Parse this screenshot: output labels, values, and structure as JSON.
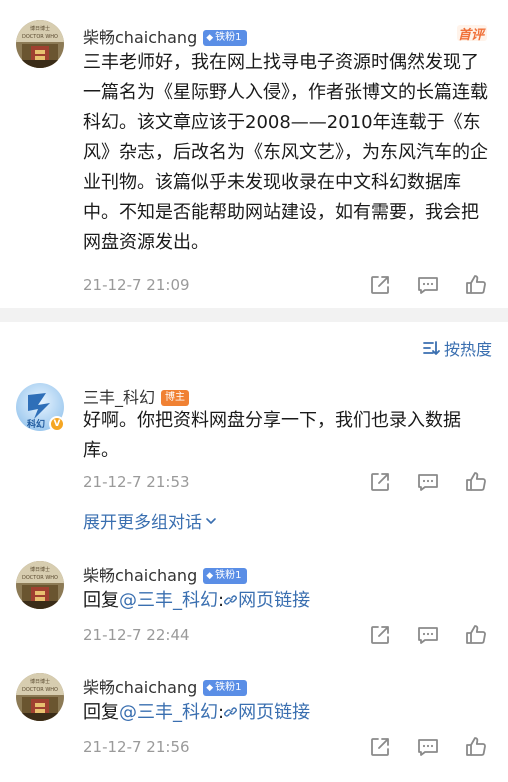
{
  "post": {
    "author": "柴畅chaichang",
    "fan_badge": "铁粉1",
    "first_tag": "首评",
    "text": "三丰老师好，我在网上找寻电子资源时偶然发现了一篇名为《星际野人入侵》，作者张博文的长篇连载科幻。该文章应该于2008——2010年连载于《东风》杂志，后改名为《东风文艺》，为东风汽车的企业刊物。该篇似乎未发现收录在中文科幻数据库中。不知是否能帮助网站建设，如有需要，我会把网盘资源发出。",
    "time": "21-12-7 21:09"
  },
  "sort": {
    "label": "按热度"
  },
  "reply1": {
    "author": "三丰_科幻",
    "host_badge": "博主",
    "text": "好啊。你把资料网盘分享一下，我们也录入数据库。",
    "time": "21-12-7 21:53"
  },
  "expand": {
    "label": "展开更多组对话"
  },
  "reply2": {
    "author": "柴畅chaichang",
    "fan_badge": "铁粉1",
    "prefix": "回复",
    "mention": "@三丰_科幻",
    "colon": ":",
    "link_label": "网页链接",
    "time": "21-12-7 22:44"
  },
  "reply3": {
    "author": "柴畅chaichang",
    "fan_badge": "铁粉1",
    "prefix": "回复",
    "mention": "@三丰_科幻",
    "colon": ":",
    "link_label": "网页链接",
    "time": "21-12-7 21:56"
  },
  "icons": [
    "share-icon",
    "comment-icon",
    "like-icon",
    "sort-icon",
    "chevron-down-icon",
    "link-icon"
  ],
  "colors": {
    "link": "#3a6fb0",
    "fan_badge": "#5a8ee6",
    "host_badge": "#f08133",
    "first_tag": "#f0713a",
    "time": "#9a9a9a"
  }
}
